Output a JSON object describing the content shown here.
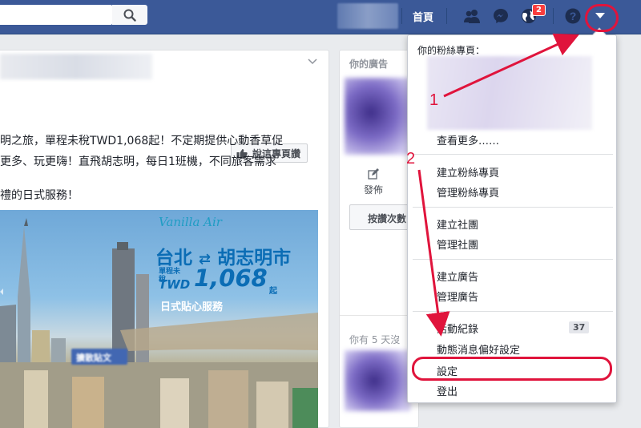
{
  "topbar": {
    "search_icon": "search-icon",
    "home_label": "首頁",
    "notification_count": "2",
    "icons": [
      "friends-icon",
      "messenger-icon",
      "globe-icon",
      "help-icon",
      "caret-down-icon"
    ],
    "bar_color": "#3b5998"
  },
  "post": {
    "like_page_label": "說這專頁讚",
    "lines": [
      "明之旅，單程未稅TWD1,068起！不定期提供心動香草促",
      "更多、玩更嗨！直飛胡志明，每日1班機，不同旅客需求",
      "禮的日式服務！"
    ],
    "ad": {
      "brand": "Vanilla Air",
      "route_from": "台北",
      "route_arrow": "⇄",
      "route_to": "胡志明市",
      "fare_prefix_1": "單程未稅",
      "fare_prefix_2": "TWD",
      "fare_amount": "1,068",
      "fare_suffix": "起",
      "service": "日式貼心服務"
    }
  },
  "ads": {
    "title": "你的廣告",
    "publish_label": "發佈",
    "boost_button": "按讚次數",
    "note": "你有 5 天沒",
    "promote_button": "擴散貼文"
  },
  "dropdown": {
    "pages_heading": "你的粉絲專頁：",
    "see_more": "查看更多……",
    "create_page": "建立粉絲專頁",
    "manage_pages": "管理粉絲專頁",
    "create_group": "建立社團",
    "manage_groups": "管理社團",
    "create_ads": "建立廣告",
    "manage_ads": "管理廣告",
    "activity_log": "活動紀錄",
    "activity_count": "37",
    "news_feed_prefs": "動態消息偏好設定",
    "settings": "設定",
    "logout": "登出"
  },
  "annotations": {
    "step1": "1",
    "step2": "2",
    "color": "#e0143c"
  }
}
